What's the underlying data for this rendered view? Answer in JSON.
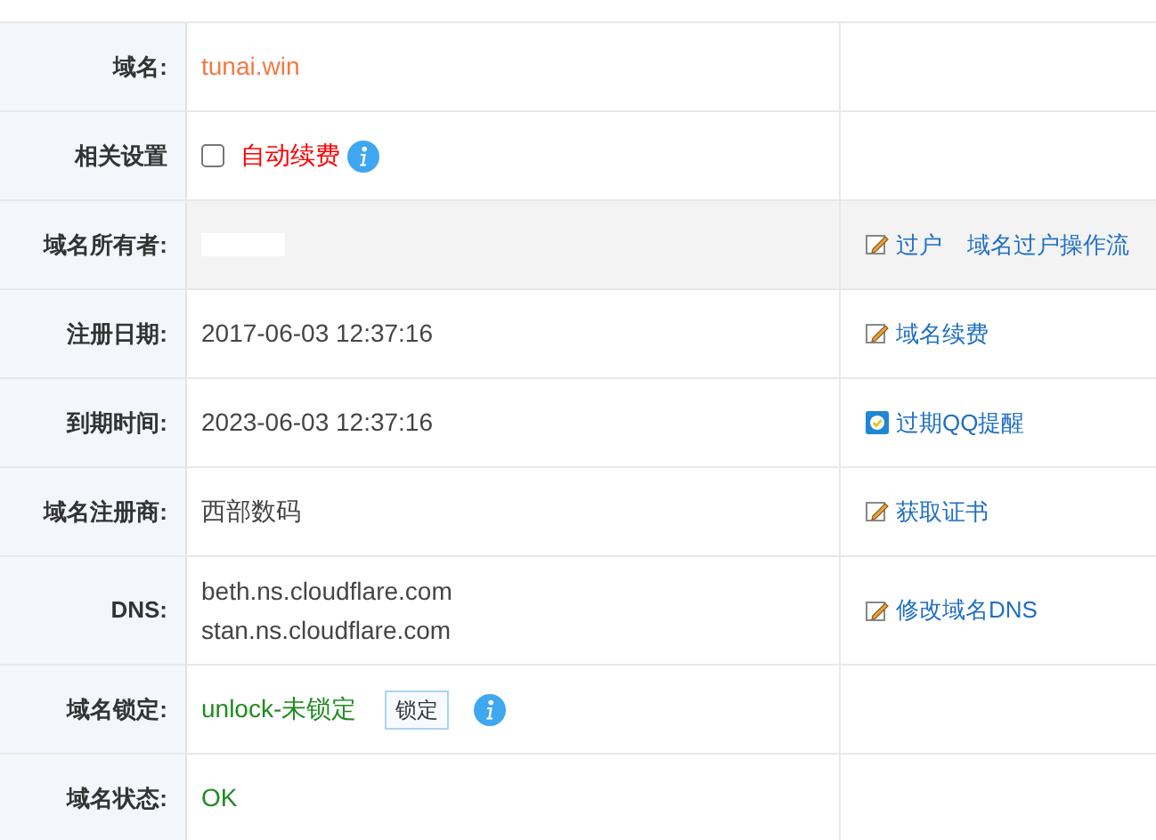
{
  "rows": [
    {
      "kind": "domain",
      "label": "域名:",
      "value": "tunai.win"
    },
    {
      "kind": "checkbox",
      "label": "相关设置",
      "option": {
        "label": "自动续费",
        "checked": false
      }
    },
    {
      "kind": "redacted",
      "label": "域名所有者:",
      "highlighted": true,
      "actions": [
        {
          "kind": "edit",
          "label": "过户"
        },
        {
          "kind": "plain",
          "label": "域名过户操作流"
        }
      ]
    },
    {
      "kind": "text",
      "label": "注册日期:",
      "value": "2017-06-03 12:37:16",
      "actions": [
        {
          "kind": "edit",
          "label": "域名续费"
        }
      ]
    },
    {
      "kind": "text",
      "label": "到期时间:",
      "value": "2023-06-03 12:37:16",
      "actions": [
        {
          "kind": "reminder",
          "label": "过期QQ提醒"
        }
      ]
    },
    {
      "kind": "text",
      "label": "域名注册商:",
      "value": "西部数码",
      "actions": [
        {
          "kind": "edit",
          "label": "获取证书"
        }
      ]
    },
    {
      "kind": "lines",
      "label": "DNS:",
      "lines": [
        "beth.ns.cloudflare.com",
        "stan.ns.cloudflare.com"
      ],
      "actions": [
        {
          "kind": "edit",
          "label": "修改域名DNS"
        }
      ]
    },
    {
      "kind": "lock",
      "label": "域名锁定:",
      "value": "unlock-未锁定",
      "button": "锁定"
    },
    {
      "kind": "status",
      "label": "域名状态:",
      "value": "OK"
    }
  ]
}
